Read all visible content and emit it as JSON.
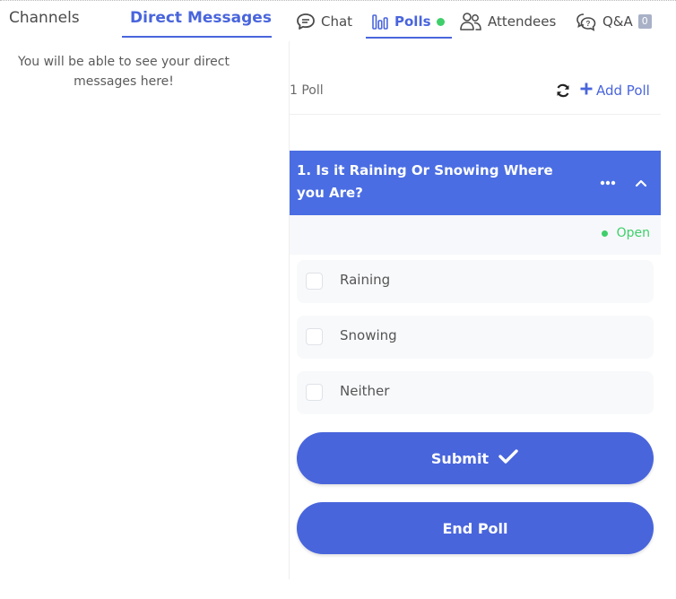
{
  "left": {
    "tabs": {
      "channels": "Channels",
      "direct_messages": "Direct Messages"
    },
    "empty_message": "You will be able to see your direct messages here!"
  },
  "right": {
    "tabs": {
      "chat": "Chat",
      "polls": "Polls",
      "attendees": "Attendees",
      "qa": "Q&A",
      "qa_count": "0"
    },
    "poll_count": "1 Poll",
    "add_poll": "Add Poll",
    "poll": {
      "question": "1. Is it Raining Or Snowing Where you Are?",
      "status": "Open",
      "options": [
        "Raining",
        "Snowing",
        "Neither"
      ],
      "submit_label": "Submit",
      "end_label": "End Poll"
    }
  },
  "colors": {
    "accent": "#4965dc",
    "header": "#4a6de3",
    "status_green": "#3ecf6a"
  },
  "icons": [
    "chat-icon",
    "polls-icon",
    "attendees-icon",
    "qa-icon",
    "refresh-icon",
    "plus-icon",
    "more-icon",
    "chevron-up-icon",
    "check-icon"
  ]
}
